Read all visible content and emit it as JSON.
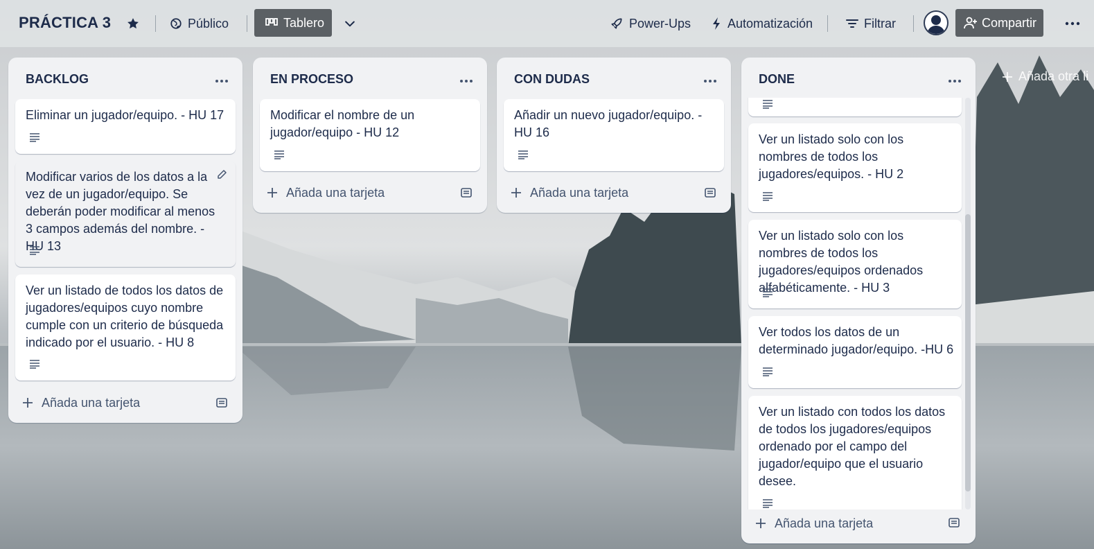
{
  "header": {
    "board_title": "PRÁCTICA 3",
    "visibility_label": "Público",
    "view_label": "Tablero",
    "powerups_label": "Power-Ups",
    "automation_label": "Automatización",
    "filter_label": "Filtrar",
    "share_label": "Compartir"
  },
  "add_list_label": "Añada otra li",
  "lists": [
    {
      "title": "BACKLOG",
      "cards": [
        {
          "text": "Eliminar un jugador/equipo. - HU 17"
        },
        {
          "text": "Modificar varios de los datos a la vez de un jugador/equipo. Se deberán poder modificar al menos 3 campos además del nombre. - HU 13"
        },
        {
          "text": "Ver un listado de todos los datos de jugadores/equipos cuyo nombre cumple con un criterio de búsqueda indicado por el usuario. - HU 8"
        }
      ],
      "add_card_label": "Añada una tarjeta"
    },
    {
      "title": "EN PROCESO",
      "cards": [
        {
          "text": "Modificar el nombre de un jugador/equipo - HU 12"
        }
      ],
      "add_card_label": "Añada una tarjeta"
    },
    {
      "title": "CON DUDAS",
      "cards": [
        {
          "text": "Añadir un nuevo jugador/equipo. - HU 16"
        }
      ],
      "add_card_label": "Añada una tarjeta"
    },
    {
      "title": "DONE",
      "cards": [
        {
          "text": ""
        },
        {
          "text": "Ver un listado solo con los nombres de todos los jugadores/equipos. - HU 2"
        },
        {
          "text": "Ver un listado solo con los nombres de todos los jugadores/equipos ordenados alfabéticamente. - HU 3"
        },
        {
          "text": "Ver todos los datos de un determinado jugador/equipo. -HU 6"
        },
        {
          "text": "Ver un listado con todos los datos de todos los jugadores/equipos ordenado por el campo del jugador/equipo que el usuario desee."
        }
      ],
      "add_card_label": "Añada una tarjeta"
    }
  ],
  "icons": {
    "star": "star-icon",
    "visibility": "globe-icon",
    "view": "board-icon",
    "chevron": "chevron-down-icon",
    "powerups": "rocket-icon",
    "automation": "lightning-icon",
    "filter": "filter-icon",
    "share": "add-person-icon",
    "more": "more-horizontal-icon",
    "description": "description-icon",
    "edit": "pencil-icon",
    "add": "plus-icon",
    "template": "card-template-icon"
  },
  "colors": {
    "header_bg": "#e2e5e7",
    "list_bg": "#f1f2f4",
    "button_dark": "#5b6064",
    "text_primary": "#1d2b4a"
  }
}
